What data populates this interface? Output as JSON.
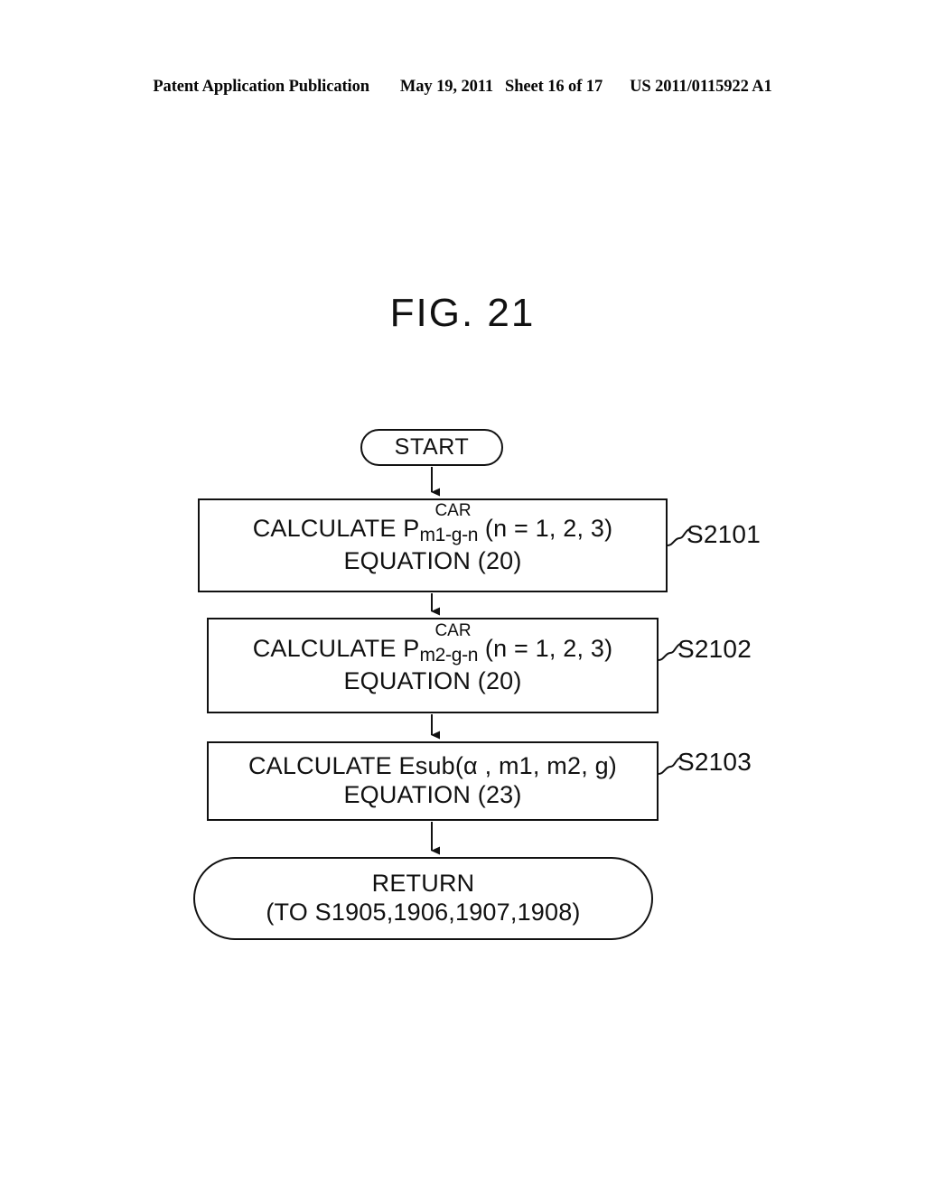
{
  "header": {
    "publication": "Patent Application Publication",
    "date": "May 19, 2011",
    "sheet": "Sheet 16 of 17",
    "patent_number": "US 2011/0115922 A1"
  },
  "figure": {
    "title": "FIG. 21"
  },
  "flowchart": {
    "start": {
      "label": "START"
    },
    "steps": [
      {
        "id": "S2101",
        "ref_label": "S2101",
        "prefix": "CALCULATE P",
        "superscript": "CAR",
        "subscript": "m1-g-n",
        "suffix": " (n = 1, 2, 3)",
        "line2": "EQUATION (20)"
      },
      {
        "id": "S2102",
        "ref_label": "S2102",
        "prefix": "CALCULATE P",
        "superscript": "CAR",
        "subscript": "m2-g-n",
        "suffix": " (n = 1, 2, 3)",
        "line2": "EQUATION (20)"
      },
      {
        "id": "S2103",
        "ref_label": "S2103",
        "line1": "CALCULATE Esub(α , m1, m2, g)",
        "line2": "EQUATION (23)"
      }
    ],
    "return": {
      "line1": "RETURN",
      "line2": "(TO S1905,1906,1907,1908)"
    }
  },
  "colors": {
    "ink": "#111111",
    "paper": "#ffffff"
  }
}
